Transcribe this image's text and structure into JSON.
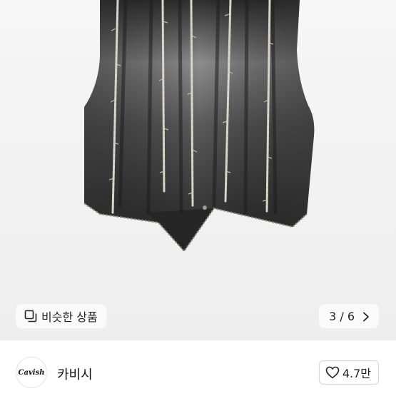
{
  "product_image": {
    "subject": "denim-vest"
  },
  "similar_button": {
    "label": "비슷한 상품",
    "icon": "similar-items-icon"
  },
  "image_pager": {
    "current": "3",
    "separator": "/",
    "total": "6",
    "text": "3 / 6",
    "icon": "chevron-right-icon"
  },
  "seller": {
    "logo_text": "Cavish",
    "name": "카비시",
    "rating_text": "4.7만",
    "rating_icon": "heart-outline-icon"
  },
  "colors": {
    "photo_background": "#f2f2f2",
    "denim_dark": "#3a3a3a",
    "denim_faded": "#8a8a8a",
    "fringe": "#d8d6c8",
    "text": "#222222"
  }
}
